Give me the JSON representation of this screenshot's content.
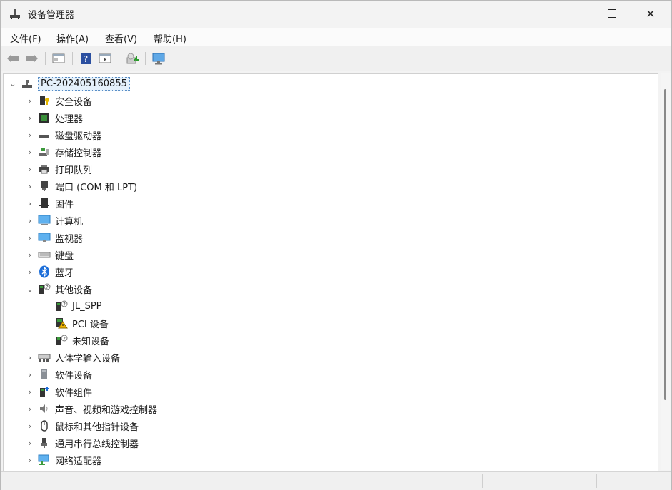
{
  "window": {
    "title": "设备管理器"
  },
  "menu": [
    "文件(F)",
    "操作(A)",
    "查看(V)",
    "帮助(H)"
  ],
  "tree": {
    "root": "PC-202405160855",
    "categories": [
      "安全设备",
      "处理器",
      "磁盘驱动器",
      "存储控制器",
      "打印队列",
      "端口 (COM 和 LPT)",
      "固件",
      "计算机",
      "监视器",
      "键盘",
      "蓝牙",
      "其他设备"
    ],
    "other_devices": [
      "JL_SPP",
      "PCI 设备",
      "未知设备"
    ],
    "categories_after": [
      "人体学输入设备",
      "软件设备",
      "软件组件",
      "声音、视频和游戏控制器",
      "鼠标和其他指针设备",
      "通用串行总线控制器",
      "网络适配器"
    ]
  }
}
